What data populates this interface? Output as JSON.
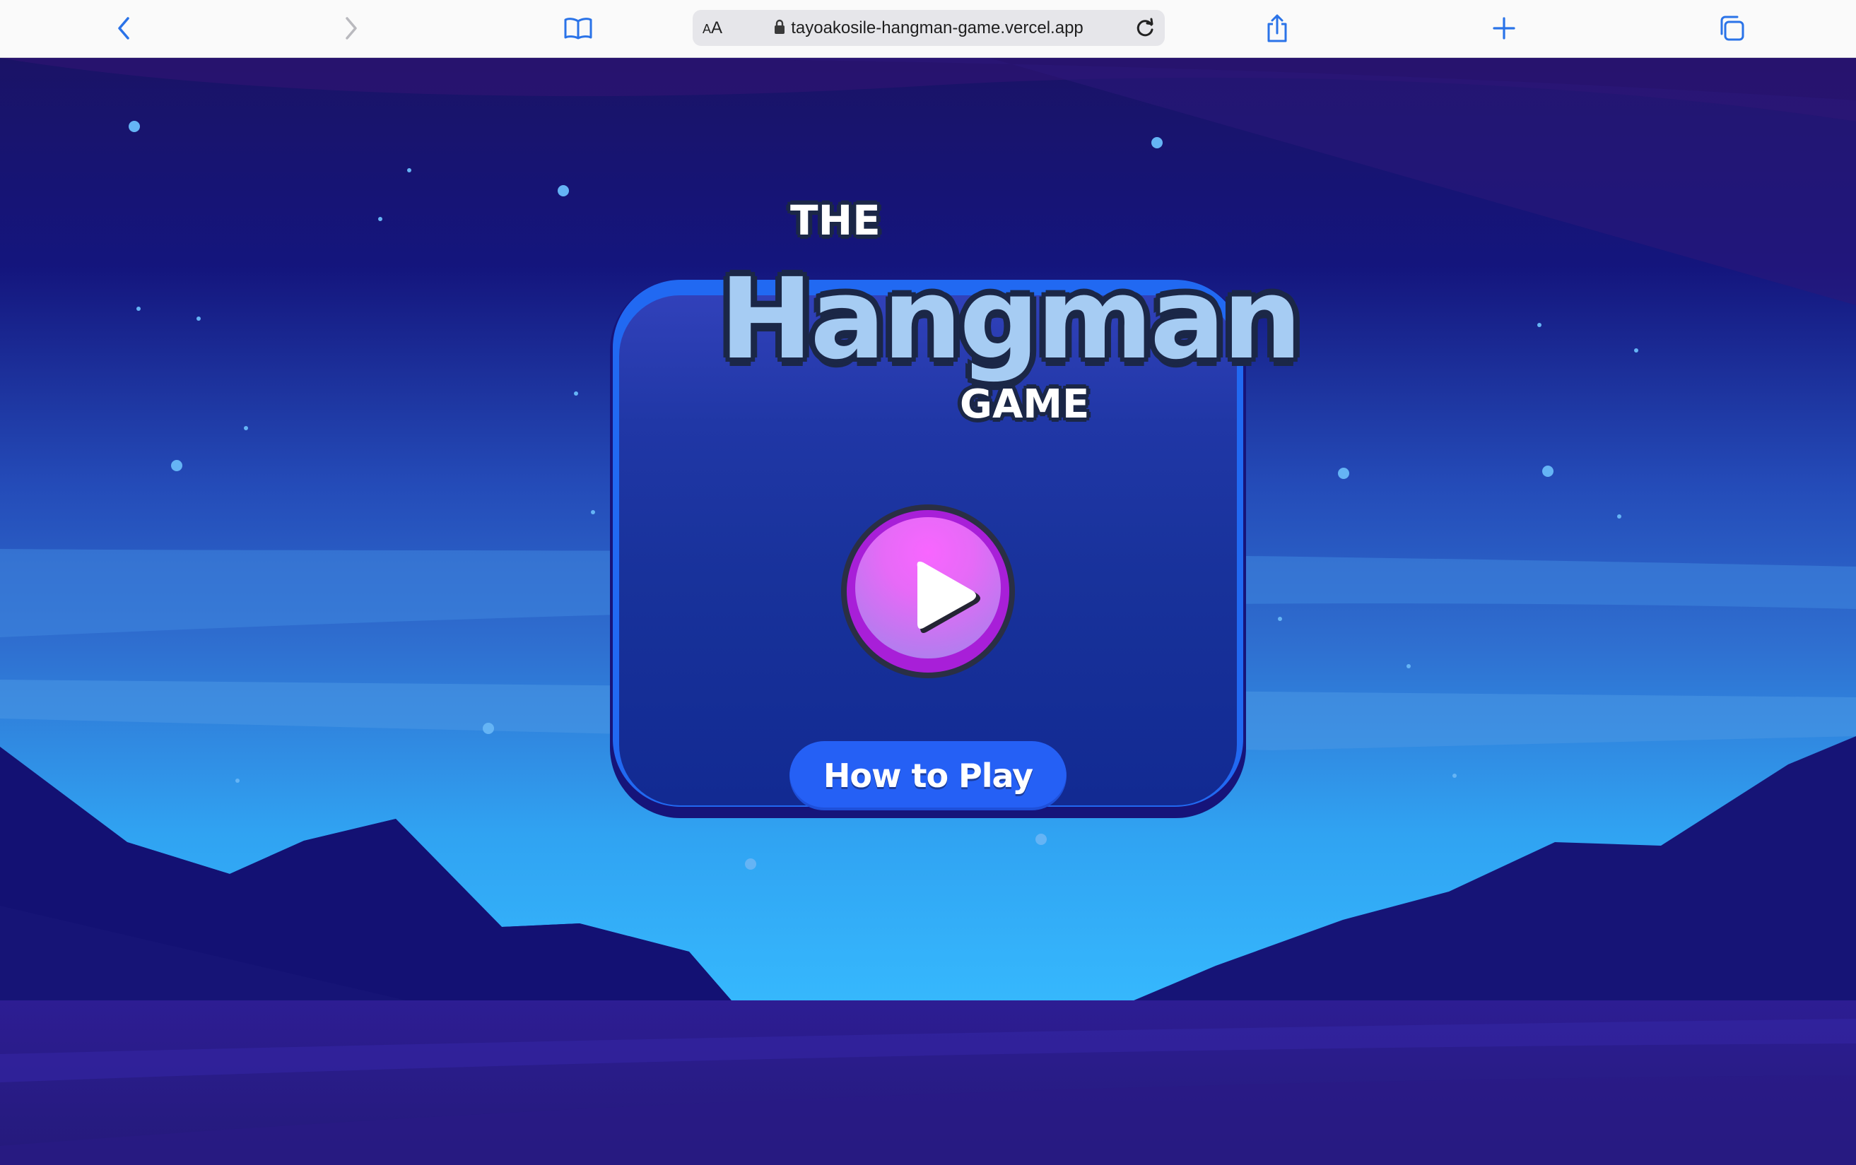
{
  "browser": {
    "url": "tayoakosile-hangman-game.vercel.app",
    "reader_label_big": "A",
    "reader_label_small": "A",
    "icons": [
      "back-icon",
      "forward-icon",
      "bookmarks-icon",
      "lock-icon",
      "reload-icon",
      "share-icon",
      "new-tab-icon",
      "tabs-icon"
    ]
  },
  "game": {
    "logo": {
      "line1": "THE",
      "line2": "Hangman",
      "line3": "GAME"
    },
    "play_icon": "play-icon",
    "how_to_play_label": "How to Play"
  },
  "colors": {
    "accent": "#2169f2",
    "button_blue": "#2560f5",
    "play_pink": "#f866ff",
    "play_purple": "#a81fd8",
    "sky_dark": "#15137a",
    "sky_light": "#33b5fb"
  }
}
